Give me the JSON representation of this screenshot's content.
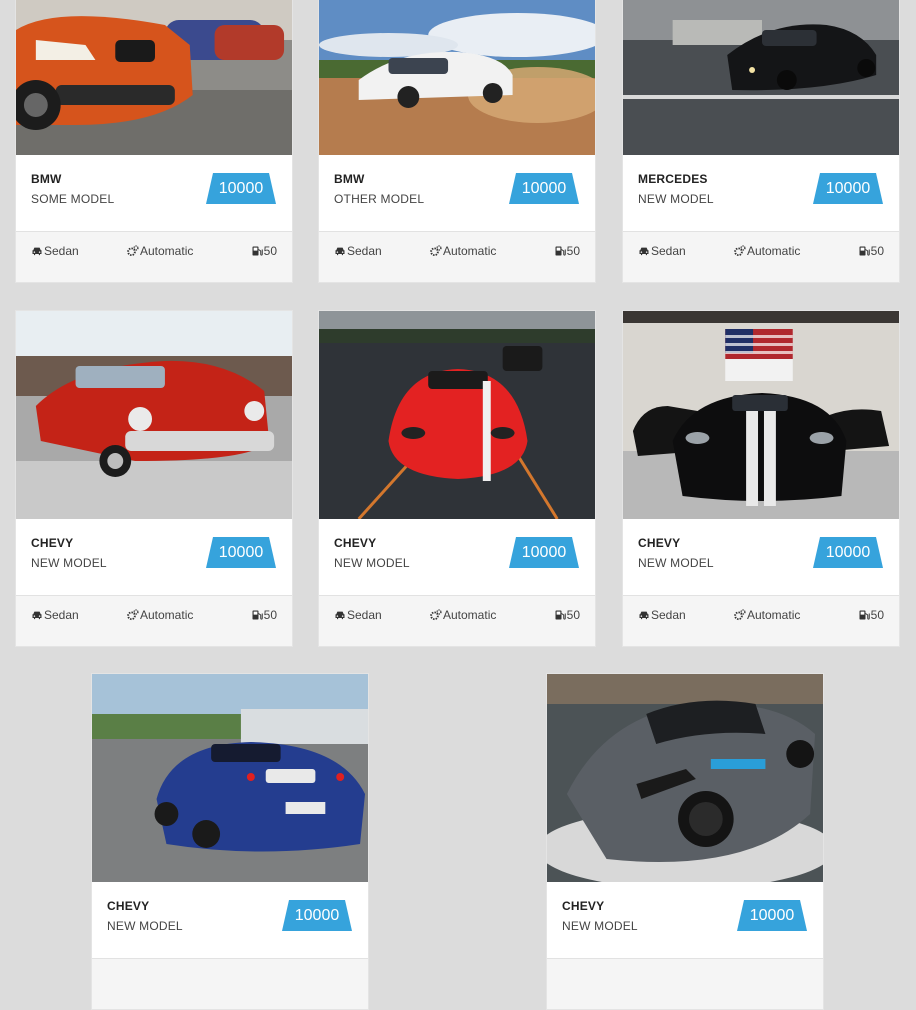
{
  "cards": [
    {
      "make": "BMW",
      "model": "SOME MODEL",
      "price": "10000",
      "body": "Sedan",
      "transmission": "Automatic",
      "fuel": "50",
      "image": "orange-bmw-photo"
    },
    {
      "make": "BMW",
      "model": "OTHER MODEL",
      "price": "10000",
      "body": "Sedan",
      "transmission": "Automatic",
      "fuel": "50",
      "image": "white-bmw-dust-photo"
    },
    {
      "make": "MERCEDES",
      "model": "NEW MODEL",
      "price": "10000",
      "body": "Sedan",
      "transmission": "Automatic",
      "fuel": "50",
      "image": "black-mercedes-photo"
    },
    {
      "make": "CHEVY",
      "model": "NEW MODEL",
      "price": "10000",
      "body": "Sedan",
      "transmission": "Automatic",
      "fuel": "50",
      "image": "red-classic-chevy-photo"
    },
    {
      "make": "CHEVY",
      "model": "NEW MODEL",
      "price": "10000",
      "body": "Sedan",
      "transmission": "Automatic",
      "fuel": "50",
      "image": "red-viper-photo"
    },
    {
      "make": "CHEVY",
      "model": "NEW MODEL",
      "price": "10000",
      "body": "Sedan",
      "transmission": "Automatic",
      "fuel": "50",
      "image": "black-viper-garage-photo"
    },
    {
      "make": "CHEVY",
      "model": "NEW MODEL",
      "price": "10000",
      "image": "blue-ferrari-track-photo"
    },
    {
      "make": "CHEVY",
      "model": "NEW MODEL",
      "price": "10000",
      "image": "grey-corvette-photo"
    }
  ],
  "colors": {
    "price_tag": "#36a3dc",
    "page_background": "#dcdcdc"
  },
  "icons": {
    "body": "car-icon",
    "transmission": "gears-icon",
    "fuel": "fuel-pump-icon"
  }
}
